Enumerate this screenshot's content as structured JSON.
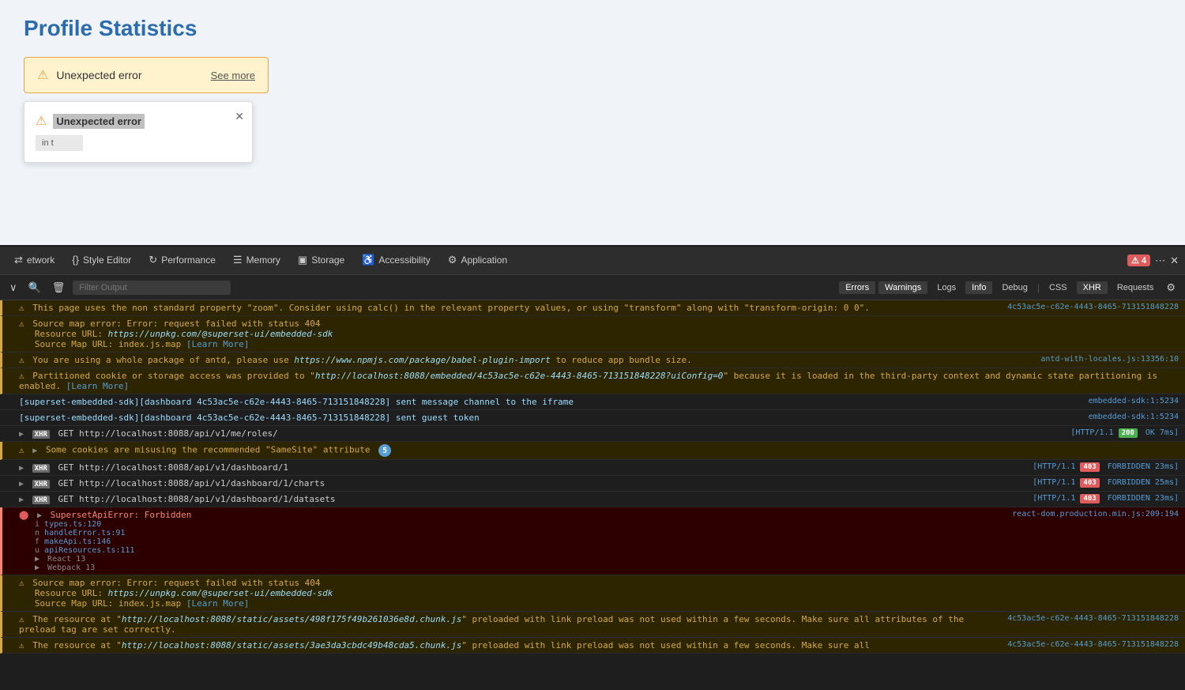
{
  "page": {
    "title": "Profile Statistics"
  },
  "error_banner": {
    "icon": "⚠",
    "text": "Unexpected error",
    "see_more": "See more"
  },
  "error_popup": {
    "icon": "⚠",
    "title": "Unexpected error",
    "detail": "in t"
  },
  "devtools": {
    "tabs": [
      {
        "label": "Network",
        "icon": "⇄"
      },
      {
        "label": "Style Editor",
        "icon": "{}"
      },
      {
        "label": "Performance",
        "icon": "↻"
      },
      {
        "label": "Memory",
        "icon": "☰"
      },
      {
        "label": "Storage",
        "icon": "▣"
      },
      {
        "label": "Accessibility",
        "icon": "♿"
      },
      {
        "label": "Application",
        "icon": "⚙"
      }
    ],
    "error_count": "4",
    "filter_placeholder": "Filter Output",
    "filter_buttons": [
      "Errors",
      "Warnings",
      "Logs",
      "Info",
      "Debug",
      "CSS",
      "XHR",
      "Requests"
    ]
  },
  "console_rows": [
    {
      "type": "warn",
      "text": "This page uses the non standard property \"zoom\". Consider using calc() in the relevant property values, or using \"transform\" along with \"transform-origin: 0 0\".",
      "source": "4c53ac5e-c62e-4443-8465-713151848228"
    },
    {
      "type": "warn",
      "multiline": true,
      "lines": [
        "Source map error: Error: request failed with status 404",
        "Resource URL: https://unpkg.com/@superset-ui/embedded-sdk",
        "Source Map URL: index.js.map [Learn More]"
      ],
      "source": ""
    },
    {
      "type": "warn",
      "text": "You are using a whole package of antd, please use https://www.npmjs.com/package/babel-plugin-import to reduce app bundle size.",
      "source": "antd-with-locales.js:13356:10"
    },
    {
      "type": "warn",
      "multiline": true,
      "lines": [
        "Partitioned cookie or storage access was provided to \"http://localhost:8088/embedded/4c53ac5e-c62e-4443-8465-713151848228?uiConfig=0\" because it is loaded in the third-party context and dynamic state partitioning is enabled. [Learn More]"
      ],
      "source": ""
    },
    {
      "type": "info",
      "text": "[superset-embedded-sdk][dashboard 4c53ac5e-c62e-4443-8465-713151848228] sent message channel to the iframe",
      "source": "embedded-sdk:1:5234"
    },
    {
      "type": "info",
      "text": "[superset-embedded-sdk][dashboard 4c53ac5e-c62e-4443-8465-713151848228] sent guest token",
      "source": "embedded-sdk:1:5234"
    },
    {
      "type": "xhr",
      "method": "GET",
      "url": "http://localhost:8088/api/v1/me/roles/",
      "status": "200",
      "statusText": "OK",
      "timing": "7ms",
      "source": "[HTTP/1.1 200 OK 7ms]"
    },
    {
      "type": "warn_expandable",
      "text": "Some cookies are misusing the recommended \"SameSite\" attribute",
      "badge": "5"
    },
    {
      "type": "xhr",
      "method": "GET",
      "url": "http://localhost:8088/api/v1/dashboard/1",
      "status": "403",
      "statusText": "FORBIDDEN",
      "timing": "23ms",
      "source": "[HTTP/1.1 403 FORBIDDEN 23ms]"
    },
    {
      "type": "xhr",
      "method": "GET",
      "url": "http://localhost:8088/api/v1/dashboard/1/charts",
      "status": "403",
      "statusText": "FORBIDDEN",
      "timing": "25ms",
      "source": "[HTTP/1.1 403 FORBIDDEN 25ms]"
    },
    {
      "type": "xhr",
      "method": "GET",
      "url": "http://localhost:8088/api/v1/dashboard/1/datasets",
      "status": "403",
      "statusText": "FORBIDDEN",
      "timing": "23ms",
      "source": "[HTTP/1.1 403 FORBIDDEN 23ms]"
    },
    {
      "type": "error_expandable",
      "text": "SupersetApiError: Forbidden",
      "source": "react-dom.production.min.js:209:194",
      "stack": [
        "i types.ts:120",
        "n handleError.ts:91",
        "f makeApi.ts:146",
        "u apiResources.ts:111",
        "▶ React 13",
        "▶ Webpack 13"
      ]
    },
    {
      "type": "warn",
      "multiline": true,
      "lines": [
        "Source map error: Error: request failed with status 404",
        "Resource URL: https://unpkg.com/@superset-ui/embedded-sdk",
        "Source Map URL: index.js.map [Learn More]"
      ],
      "source": ""
    },
    {
      "type": "warn",
      "multiline": true,
      "lines": [
        "The resource at \"http://localhost:8088/static/assets/498f175f49b261036e8d.chunk.js\" preloaded with link preload was not used within a few seconds. Make sure all attributes of the preload tag are set correctly."
      ],
      "source": "4c53ac5e-c62e-4443-8465-713151848228"
    },
    {
      "type": "warn",
      "multiline": true,
      "lines": [
        "The resource at \"http://localhost:8088/static/assets/3ae3da3cbdc49b48cda5.chunk.js\" preloaded with link preload was not used within a few seconds. Make sure all"
      ],
      "source": "4c53ac5e-c62e-4443-8465-713151848228"
    }
  ]
}
